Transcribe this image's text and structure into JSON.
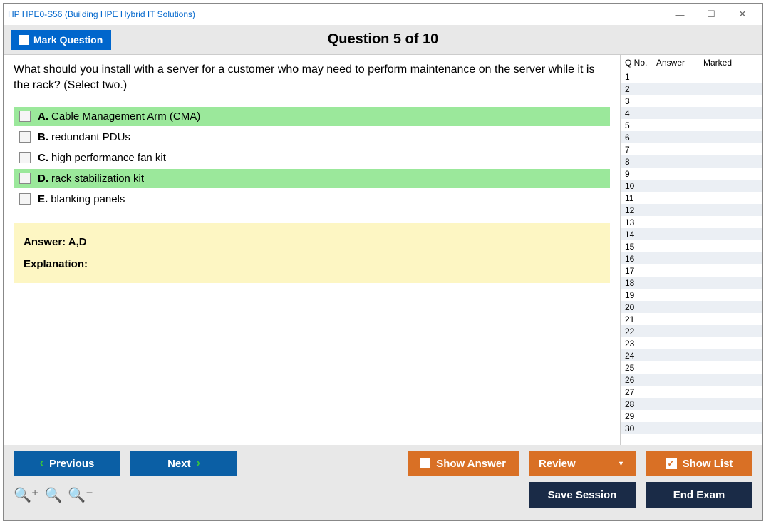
{
  "title": "HP HPE0-S56 (Building HPE Hybrid IT Solutions)",
  "header": {
    "mark": "Mark Question",
    "q_header": "Question 5 of 10"
  },
  "question": "What should you install with a server for a customer who may need to perform maintenance on the server while it is the rack? (Select two.)",
  "options": [
    {
      "letter": "A.",
      "text": "Cable Management Arm (CMA)",
      "correct": true
    },
    {
      "letter": "B.",
      "text": "redundant PDUs",
      "correct": false
    },
    {
      "letter": "C.",
      "text": "high performance fan kit",
      "correct": false
    },
    {
      "letter": "D.",
      "text": "rack stabilization kit",
      "correct": true
    },
    {
      "letter": "E.",
      "text": "blanking panels",
      "correct": false
    }
  ],
  "answer": {
    "label": "Answer: A,D",
    "explain": "Explanation:"
  },
  "side": {
    "h1": "Q No.",
    "h2": "Answer",
    "h3": "Marked",
    "rows": [
      1,
      2,
      3,
      4,
      5,
      6,
      7,
      8,
      9,
      10,
      11,
      12,
      13,
      14,
      15,
      16,
      17,
      18,
      19,
      20,
      21,
      22,
      23,
      24,
      25,
      26,
      27,
      28,
      29,
      30
    ]
  },
  "footer": {
    "prev": "Previous",
    "next": "Next",
    "show": "Show Answer",
    "review": "Review",
    "list": "Show List",
    "save": "Save Session",
    "end": "End Exam"
  }
}
